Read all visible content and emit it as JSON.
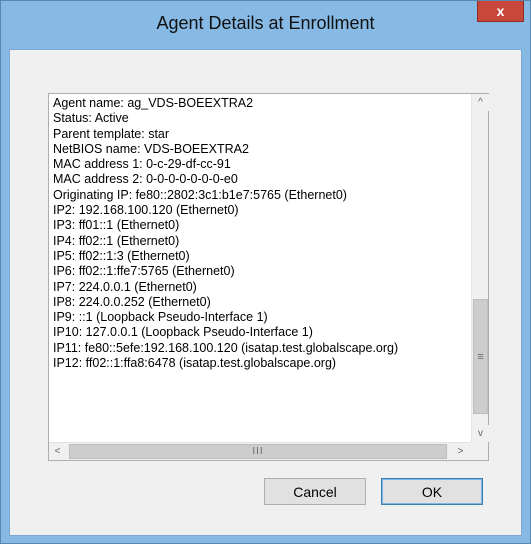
{
  "window": {
    "title": "Agent Details at Enrollment",
    "close_glyph": "x"
  },
  "details": {
    "lines": [
      "Agent name: ag_VDS-BOEEXTRA2",
      "Status: Active",
      "Parent template: star",
      "NetBIOS name: VDS-BOEEXTRA2",
      "MAC address 1: 0-c-29-df-cc-91",
      "MAC address 2: 0-0-0-0-0-0-0-e0",
      "Originating IP: fe80::2802:3c1:b1e7:5765 (Ethernet0)",
      "IP2: 192.168.100.120 (Ethernet0)",
      "IP3: ff01::1 (Ethernet0)",
      "IP4: ff02::1 (Ethernet0)",
      "IP5: ff02::1:3 (Ethernet0)",
      "IP6: ff02::1:ffe7:5765 (Ethernet0)",
      "IP7: 224.0.0.1 (Ethernet0)",
      "IP8: 224.0.0.252 (Ethernet0)",
      "IP9: ::1 (Loopback Pseudo-Interface 1)",
      "IP10: 127.0.0.1 (Loopback Pseudo-Interface 1)",
      "IP11: fe80::5efe:192.168.100.120 (isatap.test.globalscape.org)",
      "IP12: ff02::1:ffa8:6478 (isatap.test.globalscape.org)"
    ]
  },
  "scrollbars": {
    "up_glyph": "^",
    "down_glyph": "v",
    "left_glyph": "<",
    "right_glyph": ">",
    "vthumb_grip": "≡",
    "hthumb_grip": "III"
  },
  "buttons": {
    "cancel_label": "Cancel",
    "ok_label": "OK"
  }
}
